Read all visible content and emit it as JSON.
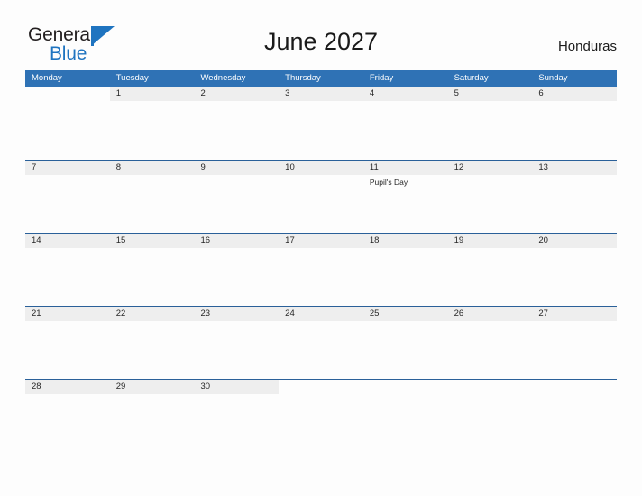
{
  "brand": {
    "name_part1": "General",
    "name_part2": "Blue",
    "color_primary": "#1f74c0",
    "color_text": "#231f20"
  },
  "header": {
    "title": "June 2027",
    "country": "Honduras"
  },
  "theme": {
    "header_blue": "#2f72b5",
    "row_line": "#2a6099",
    "day_band": "#eeeeee",
    "page_bg": "#fdfdfd"
  },
  "calendar": {
    "month": "June",
    "year": "2027",
    "weekday_headers": [
      "Monday",
      "Tuesday",
      "Wednesday",
      "Thursday",
      "Friday",
      "Saturday",
      "Sunday"
    ],
    "weeks": [
      [
        {
          "day": "",
          "events": []
        },
        {
          "day": "1",
          "events": []
        },
        {
          "day": "2",
          "events": []
        },
        {
          "day": "3",
          "events": []
        },
        {
          "day": "4",
          "events": []
        },
        {
          "day": "5",
          "events": []
        },
        {
          "day": "6",
          "events": []
        }
      ],
      [
        {
          "day": "7",
          "events": []
        },
        {
          "day": "8",
          "events": []
        },
        {
          "day": "9",
          "events": []
        },
        {
          "day": "10",
          "events": []
        },
        {
          "day": "11",
          "events": [
            "Pupil's Day"
          ]
        },
        {
          "day": "12",
          "events": []
        },
        {
          "day": "13",
          "events": []
        }
      ],
      [
        {
          "day": "14",
          "events": []
        },
        {
          "day": "15",
          "events": []
        },
        {
          "day": "16",
          "events": []
        },
        {
          "day": "17",
          "events": []
        },
        {
          "day": "18",
          "events": []
        },
        {
          "day": "19",
          "events": []
        },
        {
          "day": "20",
          "events": []
        }
      ],
      [
        {
          "day": "21",
          "events": []
        },
        {
          "day": "22",
          "events": []
        },
        {
          "day": "23",
          "events": []
        },
        {
          "day": "24",
          "events": []
        },
        {
          "day": "25",
          "events": []
        },
        {
          "day": "26",
          "events": []
        },
        {
          "day": "27",
          "events": []
        }
      ],
      [
        {
          "day": "28",
          "events": []
        },
        {
          "day": "29",
          "events": []
        },
        {
          "day": "30",
          "events": []
        },
        {
          "day": "",
          "events": []
        },
        {
          "day": "",
          "events": []
        },
        {
          "day": "",
          "events": []
        },
        {
          "day": "",
          "events": []
        }
      ]
    ]
  }
}
